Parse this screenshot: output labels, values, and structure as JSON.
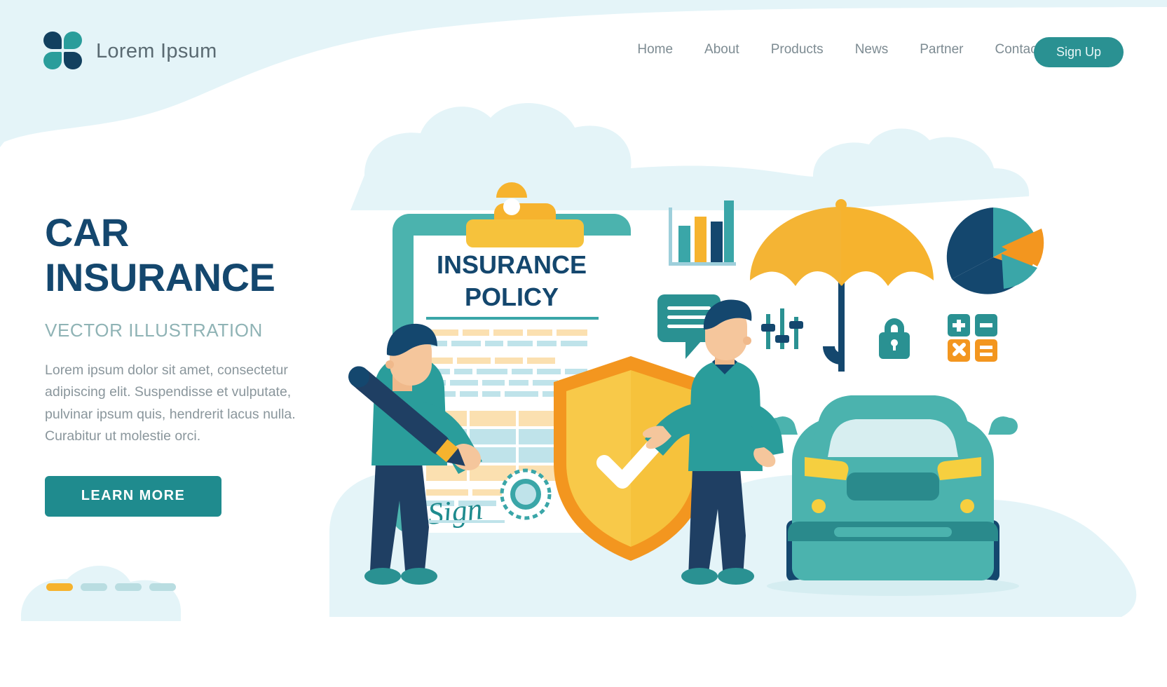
{
  "brand": {
    "name": "Lorem Ipsum",
    "logo_icon": "four-petal-logo-icon"
  },
  "nav": {
    "items": [
      {
        "label": "Home"
      },
      {
        "label": "About"
      },
      {
        "label": "Products"
      },
      {
        "label": "News"
      },
      {
        "label": "Partner"
      },
      {
        "label": "Contact"
      }
    ],
    "signup_label": "Sign Up"
  },
  "hero": {
    "title_line1": "CAR",
    "title_line2": "INSURANCE",
    "subtitle": "VECTOR ILLUSTRATION",
    "body": "Lorem ipsum dolor sit amet, consectetur adipiscing elit. Suspendisse et vulputate, pulvinar ipsum quis, hendrerit lacus nulla. Curabitur ut molestie orci.",
    "cta_label": "LEARN MORE"
  },
  "carousel": {
    "total_dots": 4,
    "active_index": 0
  },
  "illustration": {
    "clipboard": {
      "title_line1": "INSURANCE",
      "title_line2": "POLICY",
      "signature_text": "Sign",
      "clip_icon": "clipboard-clip-icon",
      "seal_icon": "official-seal-icon"
    },
    "shield": {
      "icon": "shield-check-icon"
    },
    "umbrella": {
      "icon": "umbrella-icon"
    },
    "car": {
      "icon": "car-front-icon"
    },
    "icons": [
      {
        "name": "bar-chart-icon"
      },
      {
        "name": "speech-bubble-icon"
      },
      {
        "name": "sliders-settings-icon"
      },
      {
        "name": "padlock-icon"
      },
      {
        "name": "pie-chart-icon"
      },
      {
        "name": "calculator-keys-icon"
      }
    ],
    "people": [
      {
        "name": "person-signing-with-pen"
      },
      {
        "name": "person-presenting"
      }
    ]
  },
  "colors": {
    "teal": "#2a9192",
    "teal_light": "#4bb3ae",
    "navy": "#14476e",
    "yellow": "#f6b32e",
    "orange": "#f3961f",
    "pale_blue": "#e4f4f8",
    "text_gray": "#8a969c"
  }
}
